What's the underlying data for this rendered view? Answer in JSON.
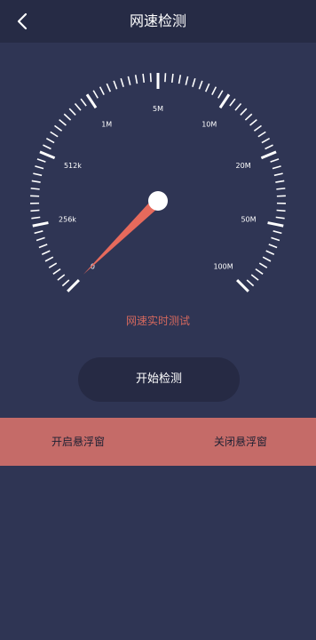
{
  "header": {
    "title": "网速检测"
  },
  "icons": {
    "back": "chevron-left-icon"
  },
  "gauge": {
    "labels": [
      "0",
      "256k",
      "512k",
      "1M",
      "5M",
      "10M",
      "20M",
      "50M",
      "100M"
    ],
    "caption": "网速实时测试",
    "needle_value": "0"
  },
  "actions": {
    "start_label": "开始检测",
    "open_float_label": "开启悬浮窗",
    "close_float_label": "关闭悬浮窗"
  },
  "colors": {
    "background": "#2f3554",
    "accent": "#e66a5c",
    "bar": "#c56b68"
  }
}
